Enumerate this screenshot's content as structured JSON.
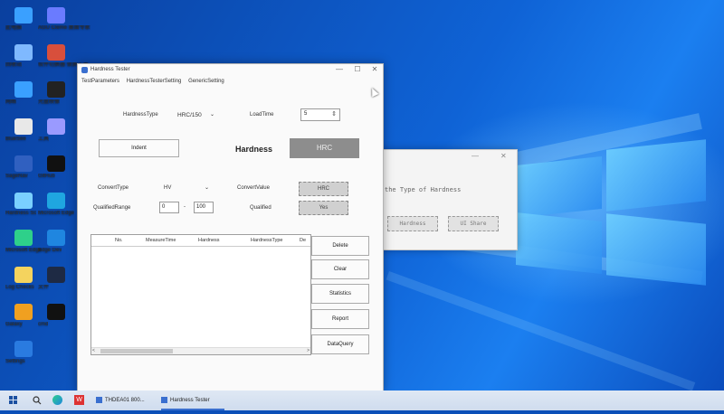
{
  "desktop": {
    "icons": [
      {
        "label": "此电脑",
        "color": "#3aa0ff"
      },
      {
        "label": "AGU Cleme 桌面专家",
        "color": "#6a7bff"
      },
      {
        "label": "回收站",
        "color": "#7fb9ff"
      },
      {
        "label": "软件切换器 锁屏工具",
        "color": "#d84f3c"
      },
      {
        "label": "网络",
        "color": "#3aa0ff"
      },
      {
        "label": "光盘映像",
        "color": "#222222"
      },
      {
        "label": "BlueSee",
        "color": "#e8e8e8"
      },
      {
        "label": "工具",
        "color": "#9a9aff"
      },
      {
        "label": "SageNav",
        "color": "#3060c0"
      },
      {
        "label": "GitHub",
        "color": "#111111"
      },
      {
        "label": "Hardness Sc",
        "color": "#7ad0ff"
      },
      {
        "label": "Microsoft Edge",
        "color": "#1fa6e0"
      },
      {
        "label": "Microsoft Edge",
        "color": "#2ed08a"
      },
      {
        "label": "Edge Dev",
        "color": "#1f86e0"
      },
      {
        "label": "Log Checks",
        "color": "#f4d35e"
      },
      {
        "label": "文件",
        "color": "#1e2a44"
      },
      {
        "label": "Galaxy",
        "color": "#f0a020"
      },
      {
        "label": "cmd",
        "color": "#111111"
      },
      {
        "label": "Settings",
        "color": "#2a7be0"
      }
    ]
  },
  "back_dialog": {
    "minimize": "—",
    "close": "✕",
    "prompt": "the Type of Hardness",
    "button_left": "Hardness",
    "button_right": "UI Share"
  },
  "window": {
    "title": "Hardness Tester",
    "minimize": "—",
    "maximize": "☐",
    "close": "✕",
    "menu": [
      "TestParameters",
      "HardnessTesterSetting",
      "GenericSetting"
    ]
  },
  "params": {
    "hardness_type_label": "HardnessType",
    "hardness_type_value": "HRC/150",
    "hardness_type_arrow": "⌄",
    "load_time_label": "LoadTime",
    "load_time_value": "5",
    "spinner": "⇕",
    "indent_button": "Indent",
    "hardness_label": "Hardness",
    "hardness_value": "HRC",
    "convert_type_label": "ConvertType",
    "convert_type_value": "HV",
    "convert_type_arrow": "⌄",
    "convert_value_label": "ConvertValue",
    "convert_value": "HRC",
    "qualified_range_label": "QualifiedRange",
    "range_min": "0",
    "range_dash": "-",
    "range_max": "100",
    "qualified_label": "Qualified",
    "qualified_value": "Yes"
  },
  "table": {
    "columns": [
      "No.",
      "MeasureTime",
      "Hardness",
      "HardnessType",
      "De"
    ],
    "scroll_left": "<",
    "scroll_right": ">"
  },
  "actions": {
    "delete": "Delete",
    "clear": "Clear",
    "statistics": "Statistics",
    "report": "Report",
    "dataquery": "DataQuery"
  },
  "taskbar": {
    "search_icon": "search-icon",
    "item1": "THDEA01 800...",
    "item2": "Hardness Tester"
  }
}
